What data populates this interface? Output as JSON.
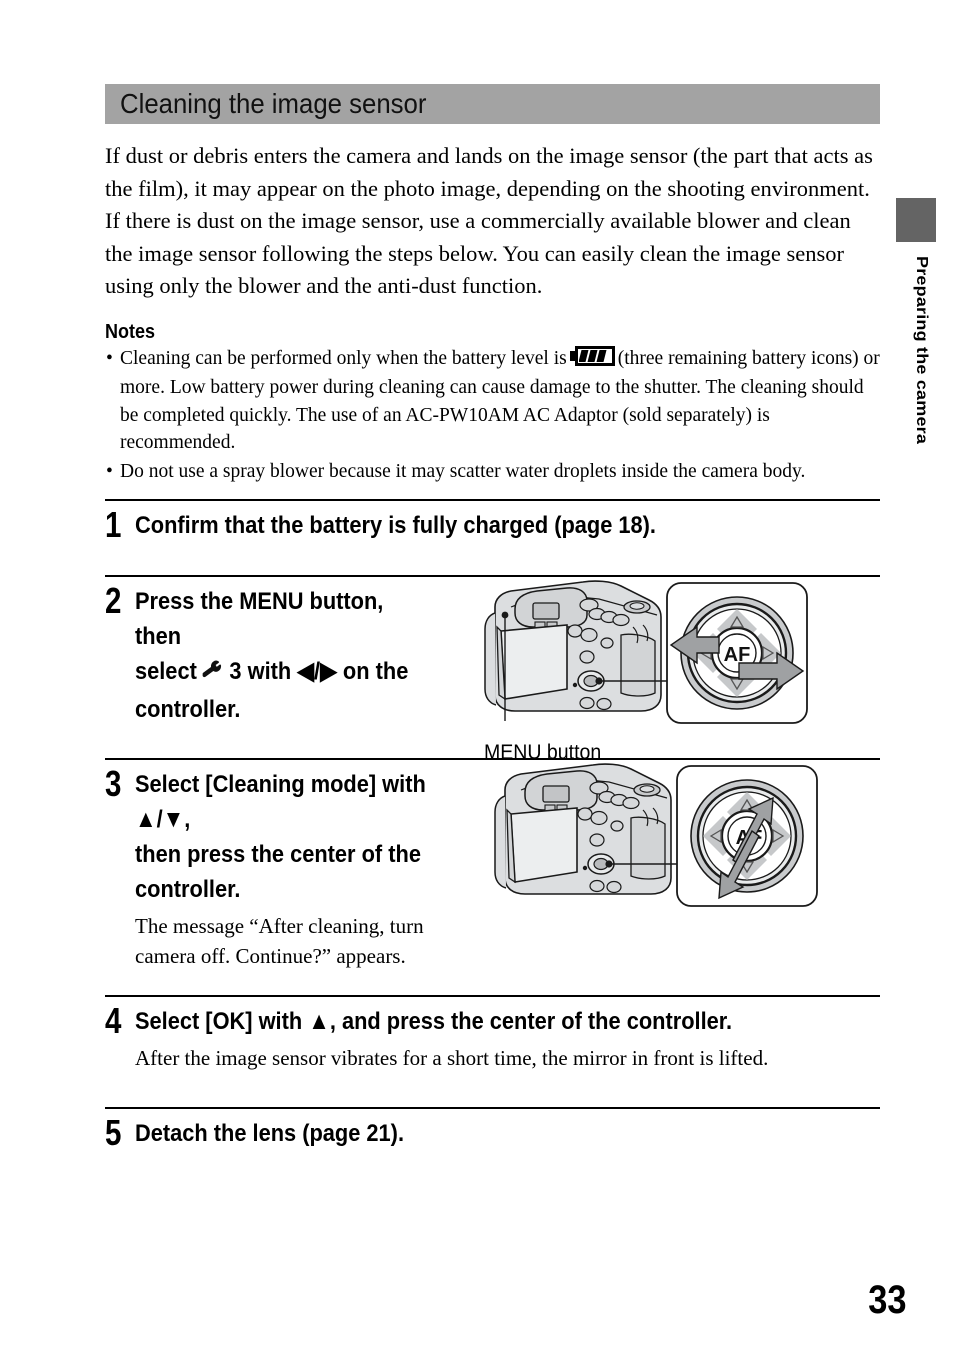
{
  "side_tab": {
    "label": "Preparing the camera",
    "block_color": "#646464"
  },
  "section": {
    "title": "Cleaning the image sensor",
    "band_color": "#a3a3a3"
  },
  "intro": "If dust or debris enters the camera and lands on the image sensor (the part that acts as the film), it may appear on the photo image, depending on the shooting environment. If there is dust on the image sensor, use a commercially available blower and clean the image sensor following the steps below. You can easily clean the image sensor using only the blower and the anti-dust function.",
  "notes": {
    "title": "Notes",
    "bullet": "•",
    "items": [
      {
        "text_before": "Cleaning can be performed only when the battery level is",
        "icon": "battery-three-bars-icon",
        "text_after": "(three remaining battery icons) or more. Low battery power during cleaning can cause damage to the shutter. The cleaning should be completed quickly. The use of an AC-PW10AM AC Adaptor (sold separately) is recommended."
      },
      {
        "text_before": "Do not use a spray blower because it may scatter water droplets inside the camera body.",
        "icon": null,
        "text_after": ""
      }
    ]
  },
  "steps": [
    {
      "number": "1",
      "heading": "Confirm that the battery is fully charged (page 18).",
      "sub": "",
      "figure": null
    },
    {
      "number": "2",
      "heading_part1": "Press the MENU button, then\nselect",
      "heading_icon": "wrench-icon",
      "heading_part2": "3 with ◀/▶ on the\ncontroller.",
      "sub": "",
      "figure": {
        "type": "camera-back-with-controller-inset",
        "callout_label": "MENU button",
        "controller_center_label": "AF",
        "arrows": "left-right"
      }
    },
    {
      "number": "3",
      "heading": "Select [Cleaning mode] with ▲/▼,\nthen press the center of the\ncontroller.",
      "sub": "The message “After cleaning, turn camera off. Continue?” appears.",
      "figure": {
        "type": "camera-back-with-controller-inset",
        "callout_label": "",
        "controller_center_label": "AF",
        "arrows": "up-down"
      }
    },
    {
      "number": "4",
      "heading": "Select [OK] with ▲, and press the center of the controller.",
      "sub": "After the image sensor vibrates for a short time, the mirror in front is lifted.",
      "figure": null
    },
    {
      "number": "5",
      "heading": "Detach the lens (page 21).",
      "sub": "",
      "figure": null
    }
  ],
  "page_number": "33"
}
